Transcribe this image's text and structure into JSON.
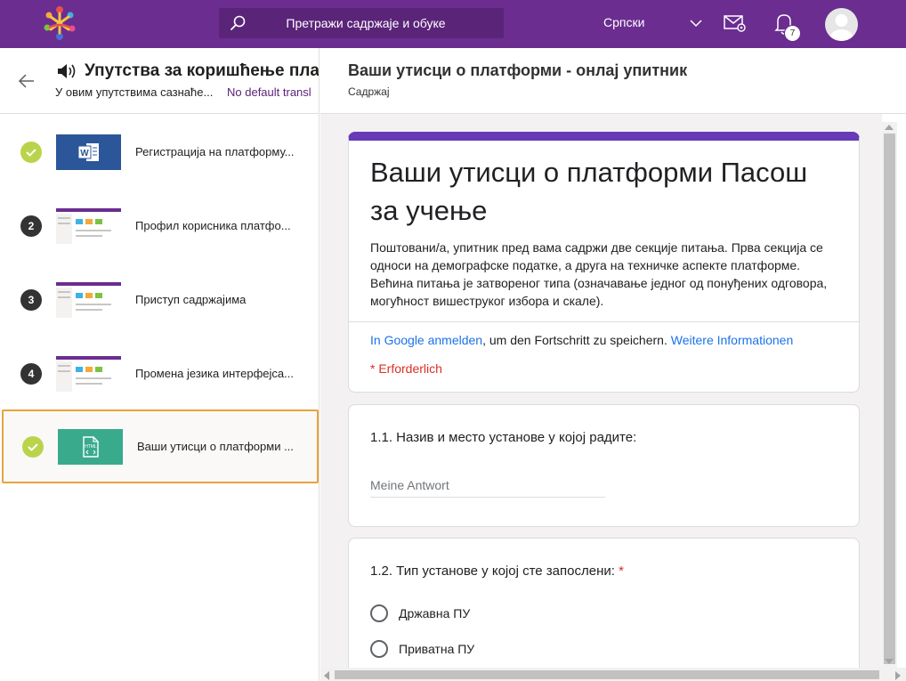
{
  "topbar": {
    "search_placeholder": "Претражи садржаје и обуке",
    "language": "Српски",
    "notification_count": "7",
    "bg_color": "#6b2d90"
  },
  "left_panel": {
    "title": "Упутства за коришћење пла",
    "subtitle": "У овим упутствима сазнаће...",
    "translation_note": "No default transl",
    "items": [
      {
        "status": "done",
        "label": "Регистрација на платформу...",
        "thumb": "word-doc-icon"
      },
      {
        "status": "2",
        "label": "Профил корисника платфо...",
        "thumb": "screenshot-thumb"
      },
      {
        "status": "3",
        "label": "Приступ садржајима",
        "thumb": "screenshot-thumb"
      },
      {
        "status": "4",
        "label": "Промена језика интерфејса...",
        "thumb": "screenshot-thumb"
      },
      {
        "status": "done",
        "label": "Ваши утисци о платформи ...",
        "thumb": "html-embed-icon"
      }
    ]
  },
  "content_header": {
    "title": "Ваши утисци о платформи - онлај упитник",
    "subtitle": "Садржај"
  },
  "form": {
    "title": "Ваши утисци о платформи Пасош за учење",
    "description": "Поштовани/а, упитник пред вама садржи две секције питања. Прва секција се односи на демографске податке, а друга на техничке аспекте платформе. Већина питања је затвореног типа (означавање једног од понуђених одговора, могућност вишеструког избора и скале).",
    "signin_link": "In Google anmelden",
    "signin_text": ", um den Fortschritt zu speichern.",
    "more_info_link": "Weitere Informationen",
    "required_note": "* Erforderlich",
    "question1": {
      "label": "1.1. Назив и место установе у којој радите:",
      "placeholder": "Meine Antwort"
    },
    "question2": {
      "label": "1.2. Тип установе у којој сте запослени: ",
      "required_mark": "*",
      "options": [
        "Државна ПУ",
        "Приватна ПУ"
      ]
    },
    "accent_color": "#673ab7"
  }
}
